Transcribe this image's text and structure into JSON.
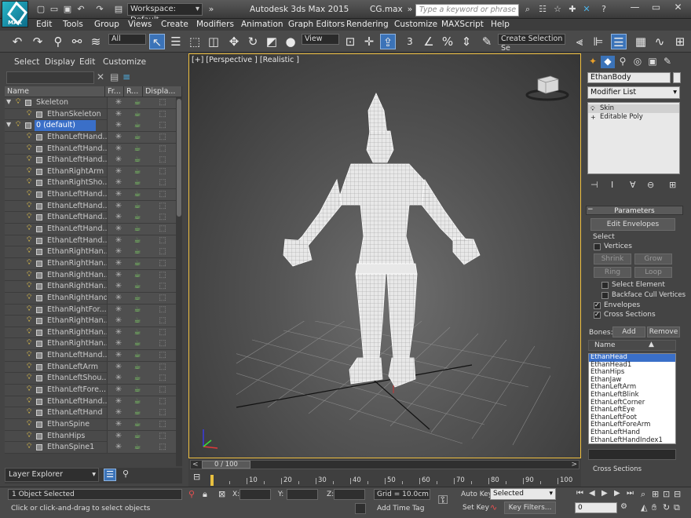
{
  "window": {
    "logo_text": "MAX",
    "app_title": "Autodesk 3ds Max  2015",
    "file_title": "CG.max",
    "workspace": "Workspace: Default",
    "search_placeholder": "Type a keyword or phrase"
  },
  "menu": [
    "Edit",
    "Tools",
    "Group",
    "Views",
    "Create",
    "Modifiers",
    "Animation",
    "Graph Editors",
    "Rendering",
    "Customize",
    "MAXScript",
    "Help"
  ],
  "toolbar": {
    "selection_filter": "All",
    "ref_coord": "View",
    "named_selection": "Create Selection Se",
    "snap_label": "3"
  },
  "scene_explorer": {
    "tabs": [
      "Select",
      "Display",
      "Edit",
      "Customize"
    ],
    "columns": {
      "name": "Name",
      "frozen": "Fr...",
      "render": "R...",
      "display": "Displa..."
    },
    "rows": [
      {
        "name": "Skeleton",
        "level": 0,
        "type": "layer"
      },
      {
        "name": "EthanSkeleton",
        "level": 1,
        "type": "object"
      },
      {
        "name": "0 (default)",
        "level": 0,
        "type": "layer",
        "selected": true
      },
      {
        "name": "EthanLeftHand...",
        "level": 1,
        "type": "object"
      },
      {
        "name": "EthanLeftHand...",
        "level": 1,
        "type": "object"
      },
      {
        "name": "EthanLeftHand...",
        "level": 1,
        "type": "object"
      },
      {
        "name": "EthanRightArm",
        "level": 1,
        "type": "object"
      },
      {
        "name": "EthanRightSho...",
        "level": 1,
        "type": "object"
      },
      {
        "name": "EthanLeftHand...",
        "level": 1,
        "type": "object"
      },
      {
        "name": "EthanLeftHand...",
        "level": 1,
        "type": "object"
      },
      {
        "name": "EthanLeftHand...",
        "level": 1,
        "type": "object"
      },
      {
        "name": "EthanLeftHand...",
        "level": 1,
        "type": "object"
      },
      {
        "name": "EthanLeftHand...",
        "level": 1,
        "type": "object"
      },
      {
        "name": "EthanRightHan...",
        "level": 1,
        "type": "object"
      },
      {
        "name": "EthanRightHan...",
        "level": 1,
        "type": "object"
      },
      {
        "name": "EthanRightHan...",
        "level": 1,
        "type": "object"
      },
      {
        "name": "EthanRightHan...",
        "level": 1,
        "type": "object"
      },
      {
        "name": "EthanRightHand",
        "level": 1,
        "type": "object"
      },
      {
        "name": "EthanRightFor...",
        "level": 1,
        "type": "object"
      },
      {
        "name": "EthanRightHan...",
        "level": 1,
        "type": "object"
      },
      {
        "name": "EthanRightHan...",
        "level": 1,
        "type": "object"
      },
      {
        "name": "EthanRightHan...",
        "level": 1,
        "type": "object"
      },
      {
        "name": "EthanLeftHand...",
        "level": 1,
        "type": "object"
      },
      {
        "name": "EthanLeftArm",
        "level": 1,
        "type": "object"
      },
      {
        "name": "EthanLeftShou...",
        "level": 1,
        "type": "object"
      },
      {
        "name": "EthanLeftFore...",
        "level": 1,
        "type": "object"
      },
      {
        "name": "EthanLeftHand...",
        "level": 1,
        "type": "object"
      },
      {
        "name": "EthanLeftHand",
        "level": 1,
        "type": "object"
      },
      {
        "name": "EthanSpine",
        "level": 1,
        "type": "object"
      },
      {
        "name": "EthanHips",
        "level": 1,
        "type": "object"
      },
      {
        "name": "EthanSpine1",
        "level": 1,
        "type": "object"
      }
    ],
    "bottom_label": "Layer Explorer"
  },
  "viewport": {
    "label": "[+] [Perspective ] [Realistic ]"
  },
  "timeline": {
    "slider_text": "0 / 100",
    "ticks": [
      0,
      10,
      20,
      30,
      40,
      50,
      60,
      70,
      80,
      90,
      100
    ],
    "current_frame": 0,
    "total_frames": 100
  },
  "command_panel": {
    "object_name": "EthanBody",
    "modifier_list": "Modifier List",
    "stack": [
      "Skin",
      "Editable Poly"
    ],
    "rollout_title": "Parameters",
    "edit_envelopes": "Edit Envelopes",
    "select_group": "Select",
    "vertices_label": "Vertices",
    "shrink": "Shrink",
    "grow": "Grow",
    "ring": "Ring",
    "loop": "Loop",
    "select_element": "Select Element",
    "backface_cull": "Backface Cull Vertices",
    "envelopes": "Envelopes",
    "cross_sections": "Cross Sections",
    "bones_label": "Bones:",
    "add": "Add",
    "remove": "Remove",
    "name_label": "Name",
    "bones": [
      "EthanHead",
      "EthanHead1",
      "EthanHips",
      "EthanJaw",
      "EthanLeftArm",
      "EthanLeftBlink",
      "EthanLeftCorner",
      "EthanLeftEye",
      "EthanLeftFoot",
      "EthanLeftForeArm",
      "EthanLeftHand",
      "EthanLeftHandIndex1"
    ],
    "cross_sections_group": "Cross Sections"
  },
  "status": {
    "selected": "1 Object Selected",
    "prompt": "Click or click-and-drag to select objects",
    "x_label": "X:",
    "y_label": "Y:",
    "z_label": "Z:",
    "grid": "Grid = 10.0cm",
    "add_time_tag": "Add Time Tag",
    "auto_key": "Auto Key",
    "set_key": "Set Key",
    "key_mode": "Selected",
    "key_filters": "Key Filters...",
    "frame": "0"
  }
}
